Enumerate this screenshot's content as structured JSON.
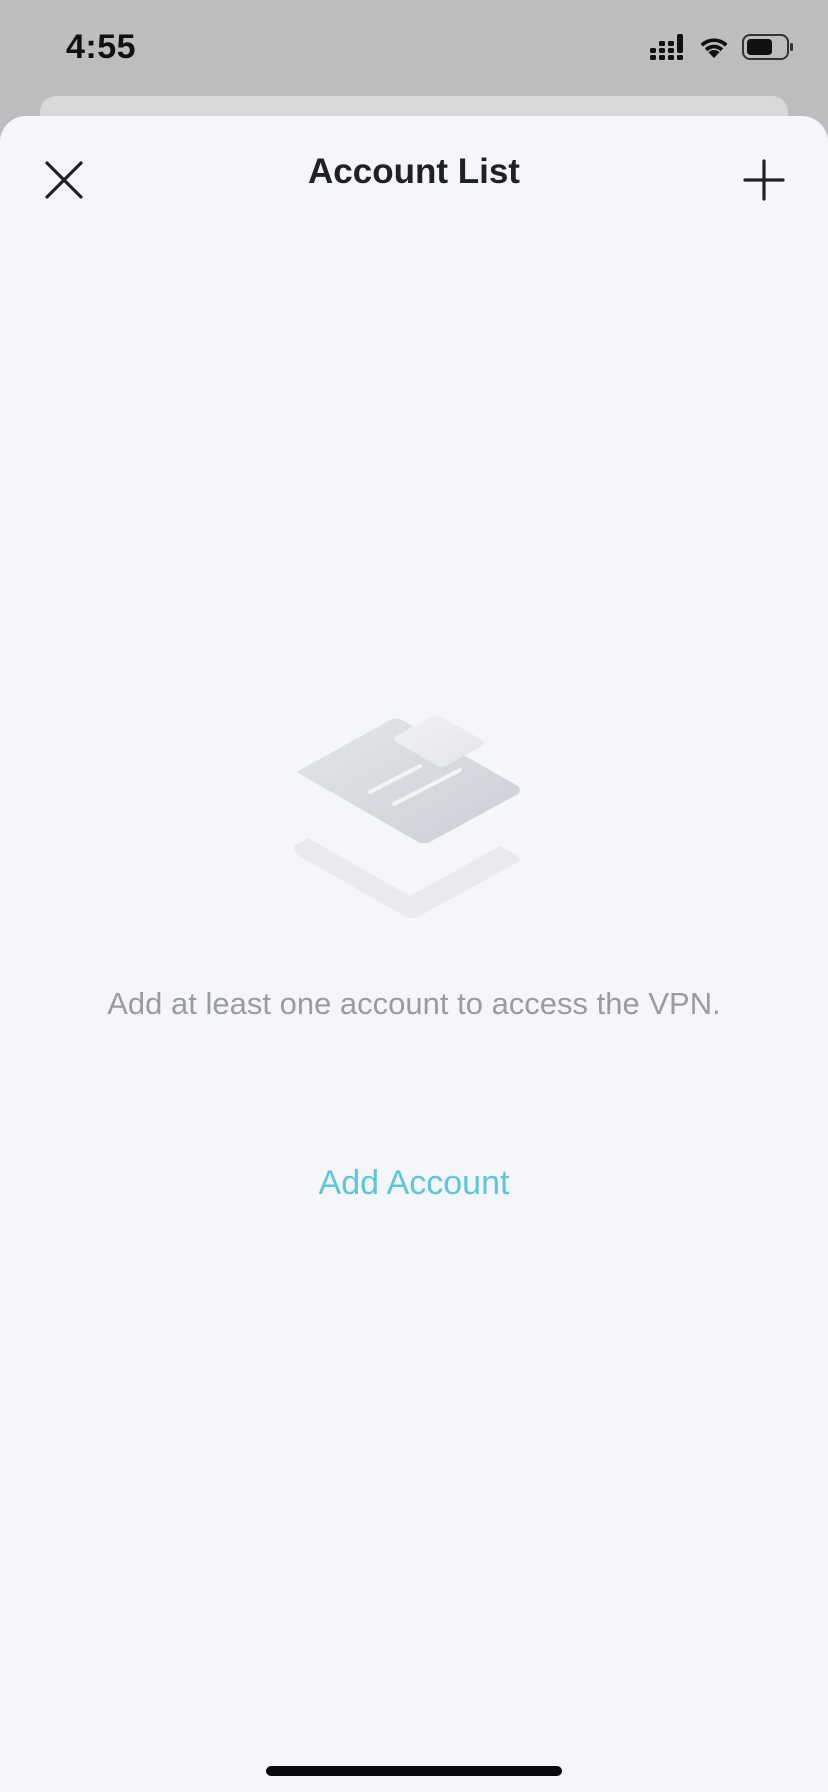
{
  "status_bar": {
    "time": "4:55",
    "icons": [
      "cellular-signal-icon",
      "wifi-icon",
      "battery-icon"
    ]
  },
  "nav": {
    "title": "Account List",
    "close_icon": "close-icon",
    "add_icon": "plus-icon"
  },
  "empty_state": {
    "illustration": "empty-documents-icon",
    "message": "Add at least one account to access the VPN.",
    "action_label": "Add Account"
  },
  "colors": {
    "accent": "#5cc6dc",
    "sheet_background": "#f4f6f9",
    "title_text": "#1f2124",
    "muted_text": "#9a9ca0"
  }
}
